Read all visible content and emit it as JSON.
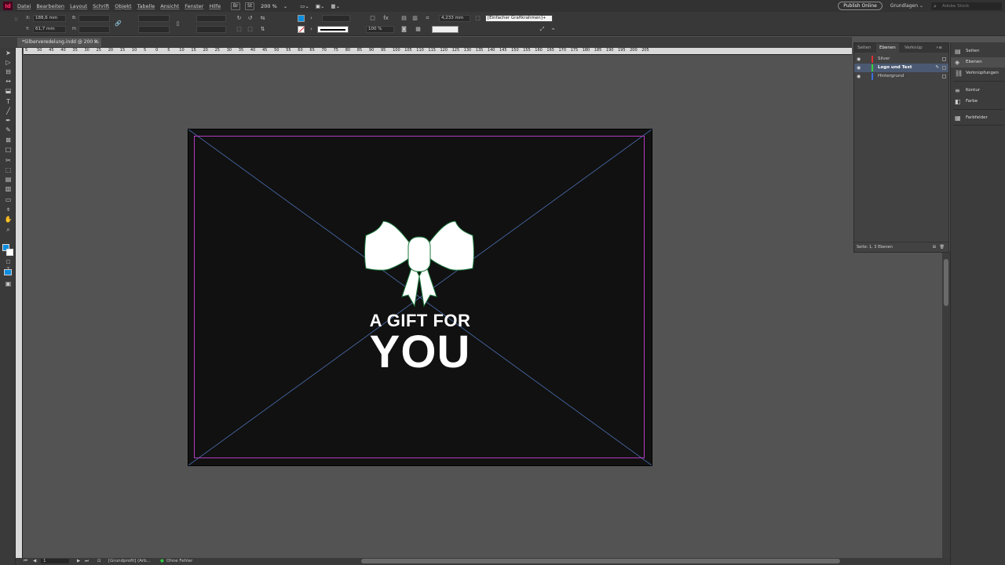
{
  "app": {
    "logo": "Id"
  },
  "menu": [
    "Datei",
    "Bearbeiten",
    "Layout",
    "Schrift",
    "Objekt",
    "Tabelle",
    "Ansicht",
    "Fenster",
    "Hilfe"
  ],
  "menubar_ctl": {
    "bridge": "Br",
    "stock": "St",
    "zoom": "200 %"
  },
  "menubar_right": {
    "publish": "Publish Online",
    "workspace": "Grundlagen",
    "search_placeholder": "Adobe Stock"
  },
  "control": {
    "x_label": "X:",
    "x_value": "188,6 mm",
    "y_label": "Y:",
    "y_value": "61,7 mm",
    "w_label": "B:",
    "h_label": "H:",
    "stroke_weight": "4,233 mm",
    "scale_x": "100 %",
    "scale_y": "100 %",
    "object_style": "[Einfacher Grafikrahmen]+"
  },
  "document": {
    "tab_title": "*Silberveredelung.indd @ 200 %"
  },
  "ruler": [
    "5",
    "50",
    "45",
    "40",
    "35",
    "30",
    "25",
    "20",
    "15",
    "10",
    "5",
    "0",
    "5",
    "10",
    "15",
    "20",
    "25",
    "30",
    "35",
    "40",
    "45",
    "50",
    "55",
    "60",
    "65",
    "70",
    "75",
    "80",
    "85",
    "90",
    "95",
    "100",
    "105",
    "110",
    "115",
    "120",
    "125",
    "130",
    "135",
    "140",
    "145",
    "150",
    "155",
    "160",
    "165",
    "170",
    "175",
    "180",
    "185",
    "190",
    "195",
    "200",
    "205"
  ],
  "artwork": {
    "line1": "A GIFT FOR",
    "line2": "YOU"
  },
  "layers_panel": {
    "tabs": [
      "Seiten",
      "Ebenen",
      "Verknüp"
    ],
    "layers": [
      {
        "name": "Silver",
        "color": "#e03030",
        "selected": false
      },
      {
        "name": "Logo und Text",
        "color": "#3ad13a",
        "selected": true
      },
      {
        "name": "Hintergrund",
        "color": "#3a6ee0",
        "selected": false
      }
    ],
    "footer": "Seite: 1, 3 Ebenen"
  },
  "dock": [
    "Seiten",
    "Ebenen",
    "Verknüpfungen",
    "Kontur",
    "Farbe",
    "Farbfelder"
  ],
  "status": {
    "page": "1",
    "master": "[Grundprofil] (Arb...",
    "preflight": "Ohne Fehler"
  },
  "colors": {
    "page": "#111111",
    "margin": "#b43ac3",
    "fill_swatch": "#0c8ee0"
  }
}
